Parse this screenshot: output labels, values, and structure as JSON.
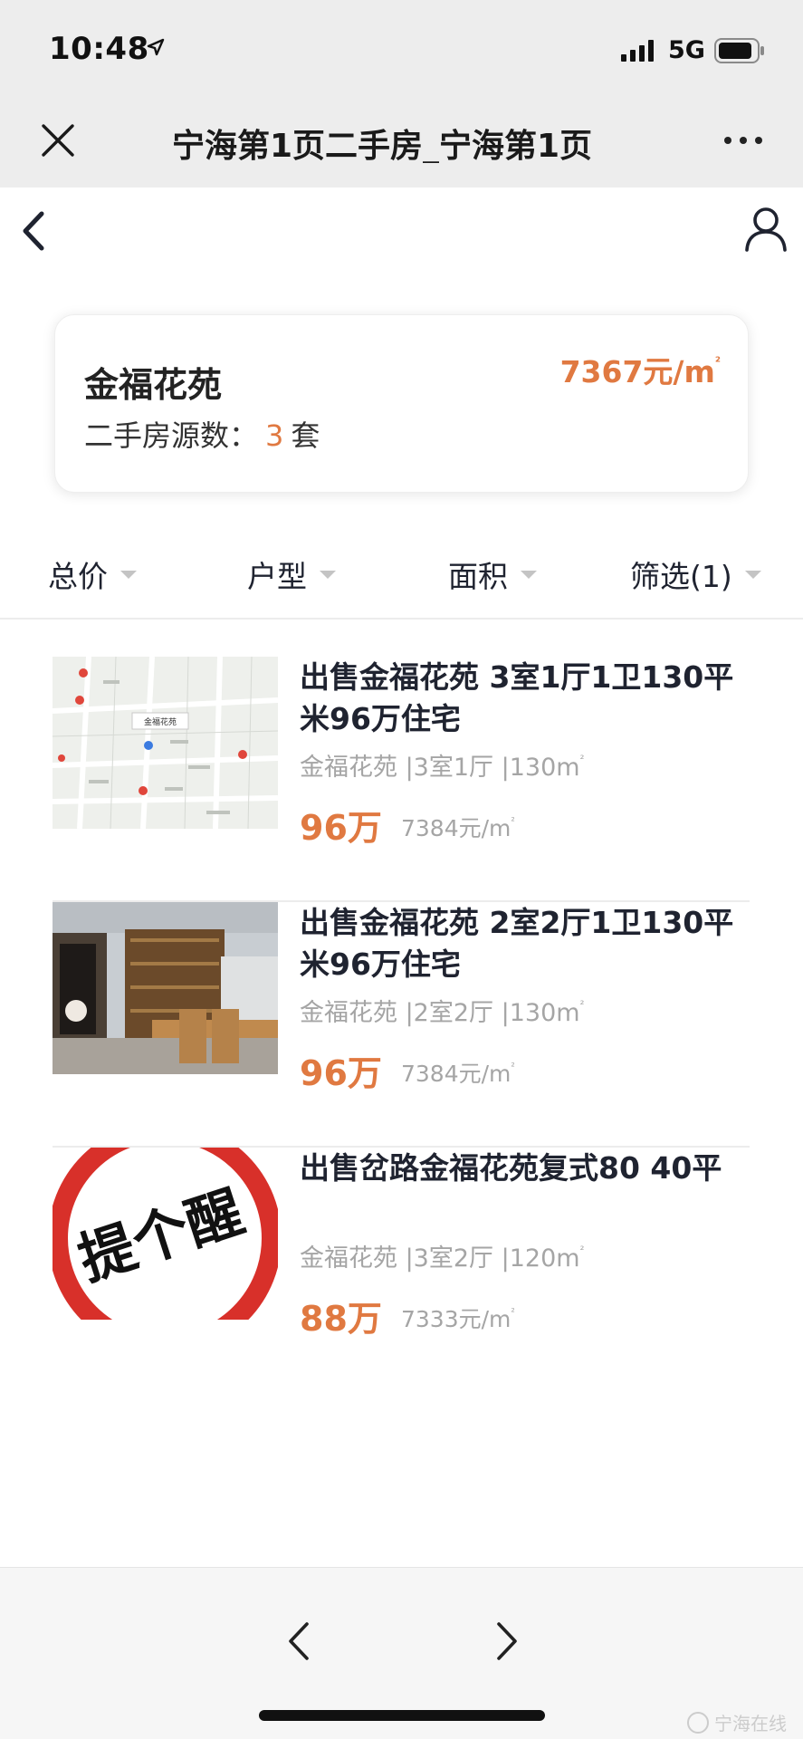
{
  "status_bar": {
    "time": "10:48",
    "network": "5G"
  },
  "wechat_bar": {
    "title": "宁海第1页二手房_宁海第1页"
  },
  "estate": {
    "name": "金福花苑",
    "count_label": "二手房源数：",
    "count": "3",
    "count_unit": "套",
    "avg_price": "7367元/m",
    "avg_price_sup": "²"
  },
  "filters": [
    {
      "label": "总价"
    },
    {
      "label": "户型"
    },
    {
      "label": "面积"
    },
    {
      "label": "筛选(1)"
    }
  ],
  "listings": [
    {
      "title": "出售金福花苑 3室1厅1卫130平米96万住宅",
      "meta": "金福花苑 |3室1厅 |130m",
      "meta_sup": "²",
      "price": "96万",
      "unit_price": "7384元/m",
      "unit_sup": "²",
      "thumb": "map-thumbnail"
    },
    {
      "title": "出售金福花苑 2室2厅1卫130平米96万住宅",
      "meta": "金福花苑 |2室2厅 |130m",
      "meta_sup": "²",
      "price": "96万",
      "unit_price": "7384元/m",
      "unit_sup": "²",
      "thumb": "room-photo-thumbnail"
    },
    {
      "title": "出售岔路金福花苑复式80 40平",
      "meta": "金福花苑 |3室2厅 |120m",
      "meta_sup": "²",
      "price": "88万",
      "unit_price": "7333元/m",
      "unit_sup": "²",
      "thumb": "reminder-sign-thumbnail",
      "thumb_text": "提个醒"
    }
  ],
  "map_thumb": {
    "label": "金福花苑"
  },
  "watermark": {
    "text": "宁海在线"
  },
  "colors": {
    "accent": "#e07941",
    "text": "#1f2330",
    "muted": "#a5a5a5",
    "chrome": "#ededed"
  }
}
